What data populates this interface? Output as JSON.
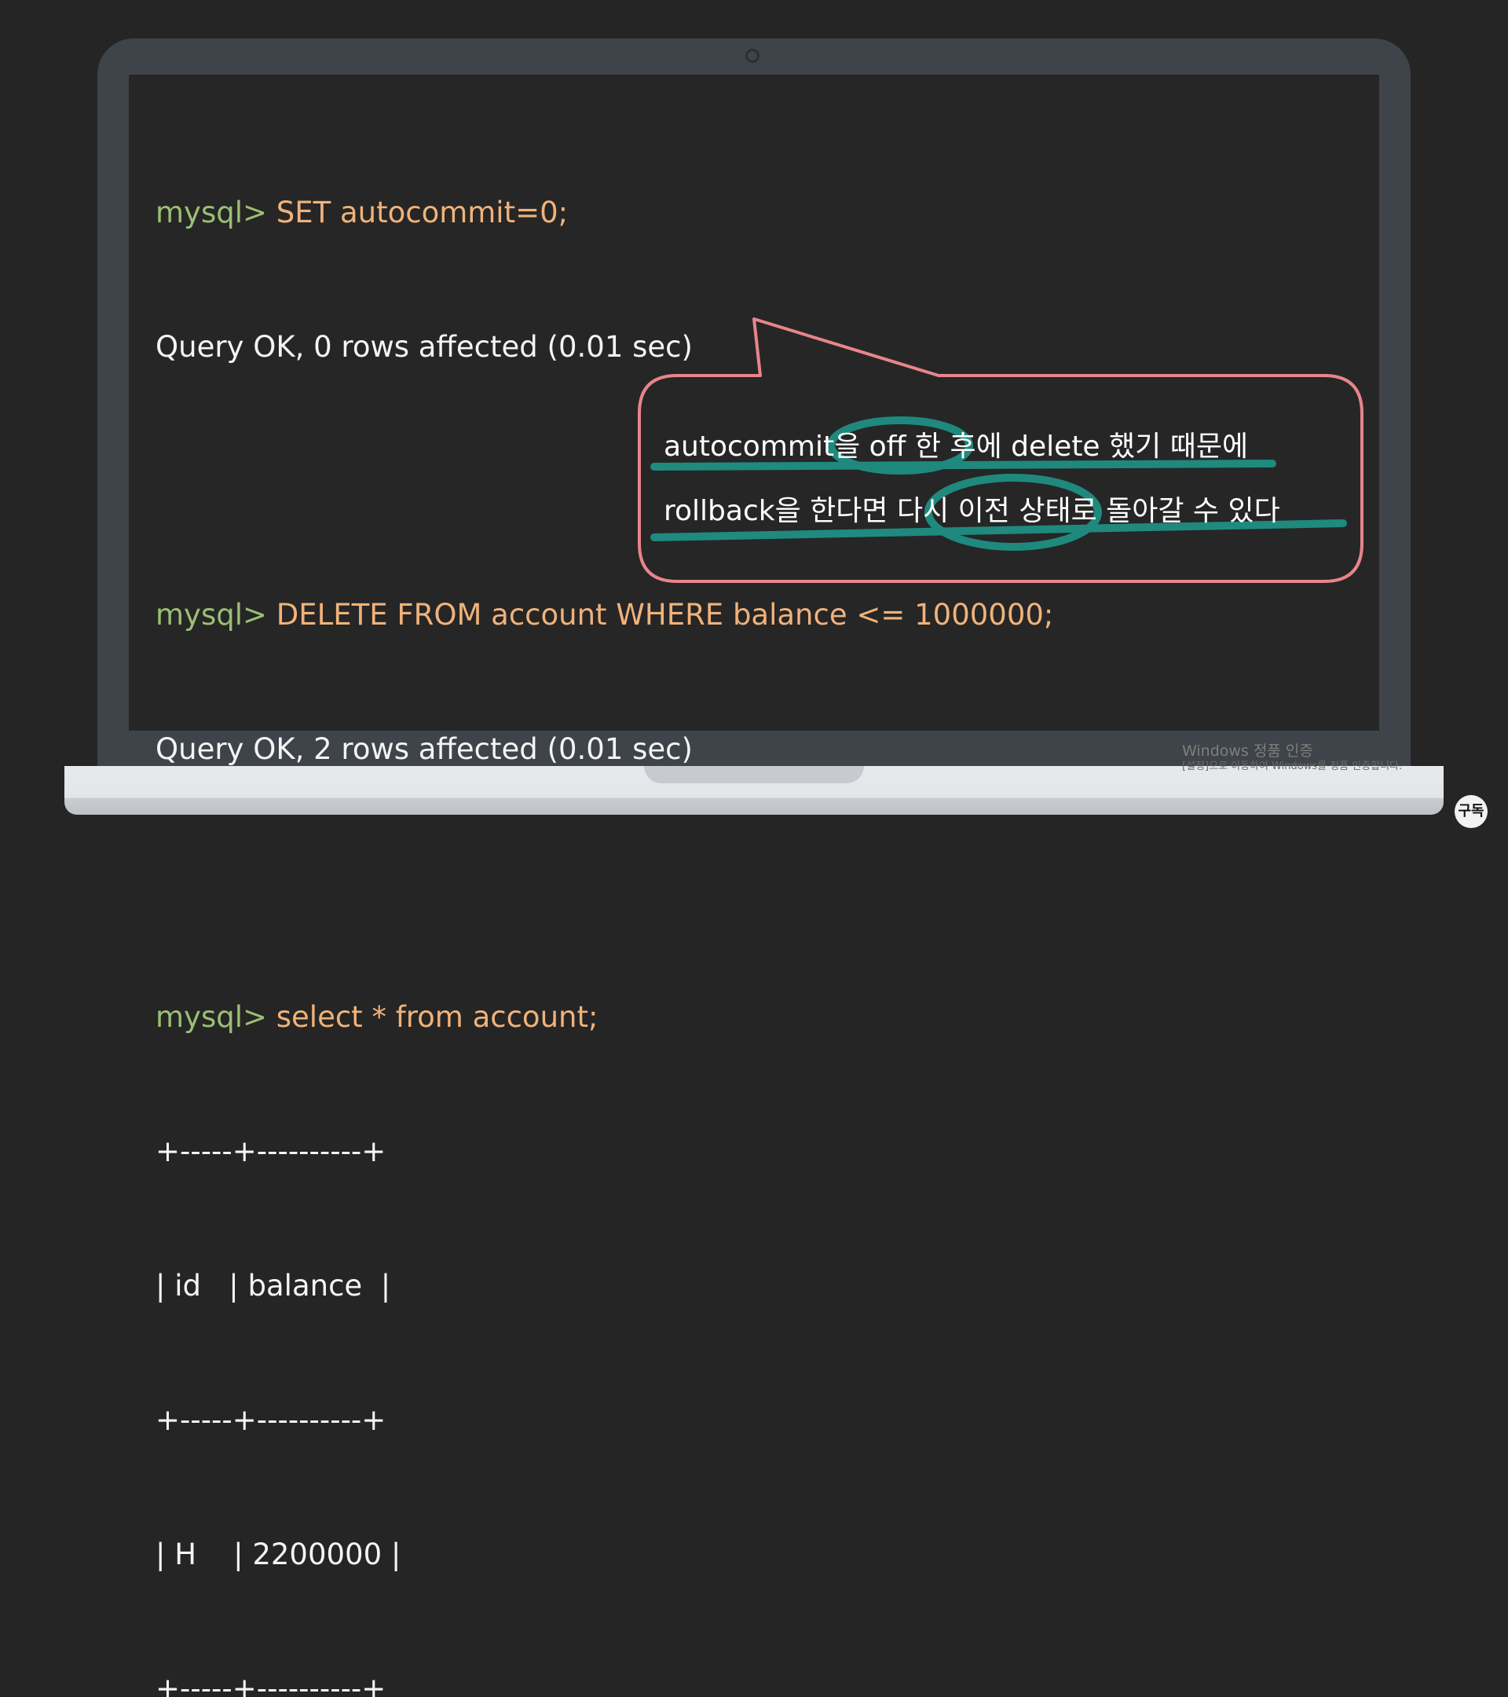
{
  "terminal": {
    "prompt": "mysql>",
    "cmd1": " SET autocommit=0;",
    "out1": "Query OK, 0 rows affected (0.01 sec)",
    "cmd2": " DELETE FROM account WHERE balance <= 1000000;",
    "out2": "Query OK, 2 rows affected (0.01 sec)",
    "cmd3": " select * from account;",
    "table": {
      "border": "+-----+----------+",
      "header": "| id   | balance  |",
      "rows": [
        "| H    | 2200000 |"
      ]
    }
  },
  "bubble": {
    "line1": "autocommit을 off 한 후에 delete 했기 때문에",
    "line2": "rollback을 한다면 다시 이전 상태로 돌아갈 수 있다"
  },
  "watermark": {
    "title": "Windows 정품 인증",
    "subtitle": "[설정]으로 이동하여 Windows를 정품 인증합니다."
  },
  "subscribe_label": "구독",
  "colors": {
    "prompt": "#9bbf74",
    "command": "#f0b27a",
    "bubble_border": "#e8858b",
    "highlight": "#1f8f83"
  }
}
